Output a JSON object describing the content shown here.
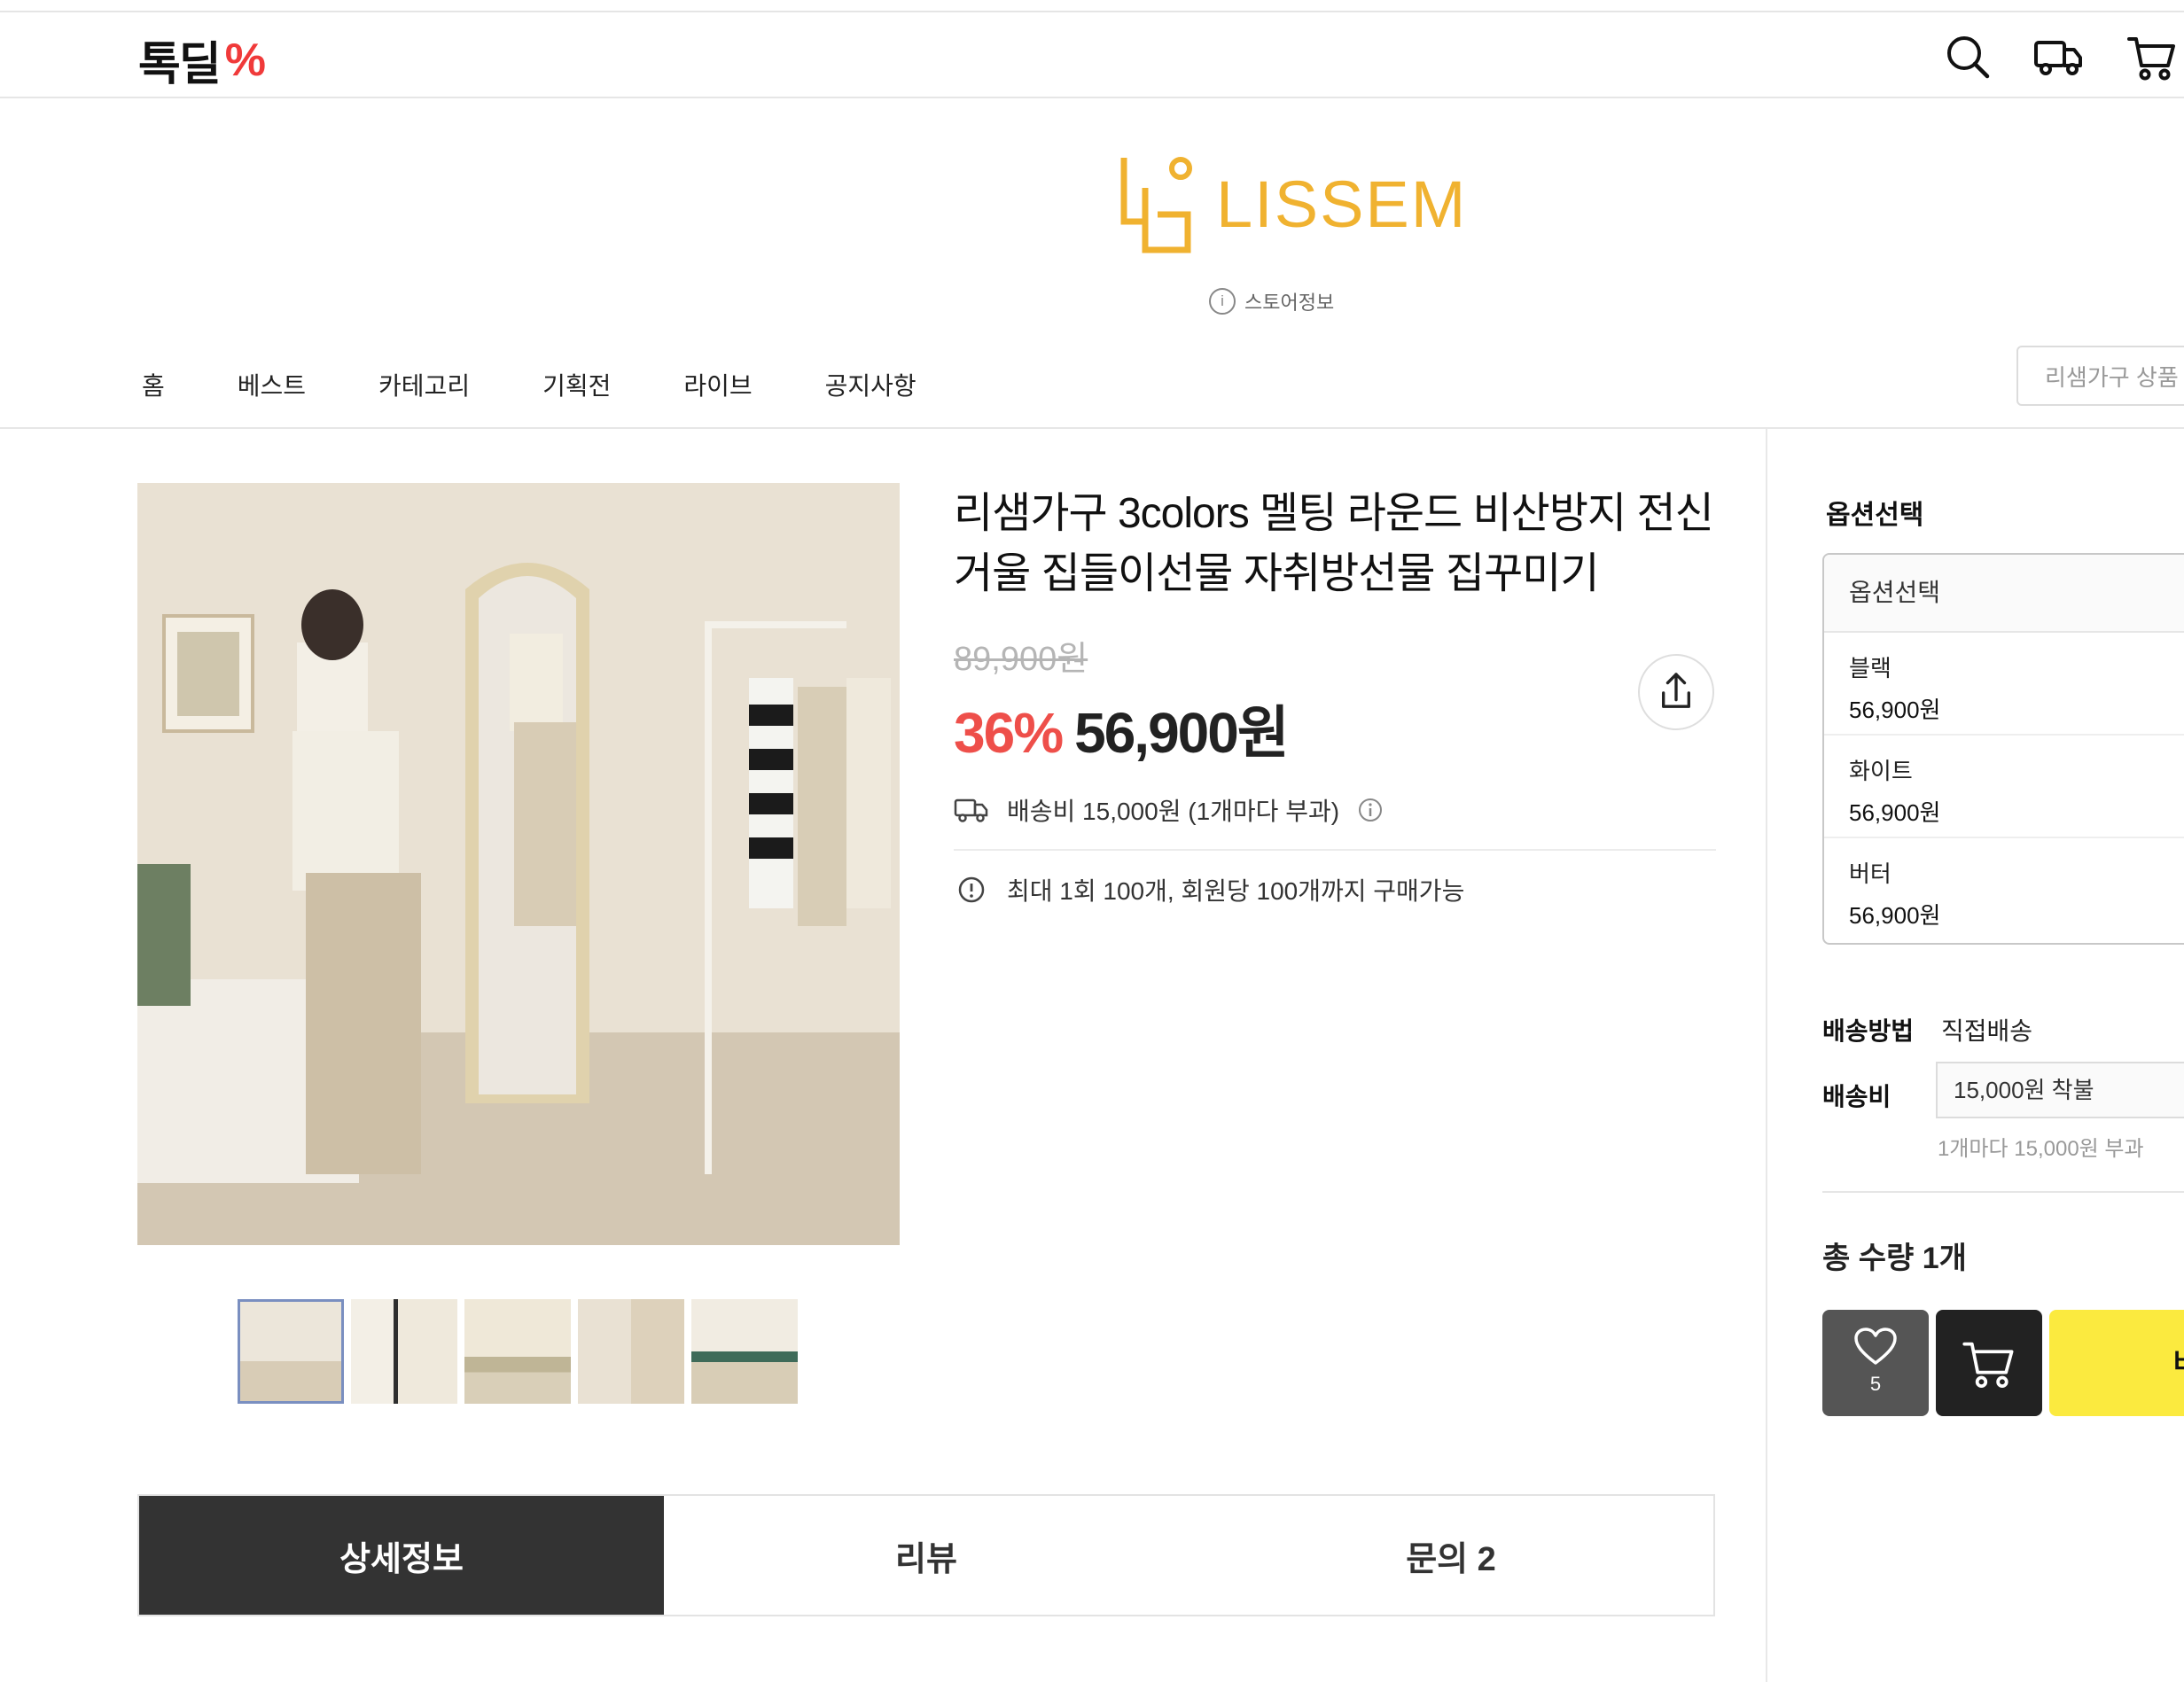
{
  "header": {
    "logo_text": "톡딜",
    "logo_mark": "%",
    "icons": [
      "search-icon",
      "truck-icon",
      "cart-icon"
    ]
  },
  "brand": {
    "name": "LISSEM",
    "store_info": "스토어정보"
  },
  "nav": {
    "items": [
      "홈",
      "베스트",
      "카테고리",
      "기획전",
      "라이브",
      "공지사항"
    ],
    "search_placeholder": "리샘가구 상품"
  },
  "product": {
    "title": "리샘가구 3colors 멜팅 라운드 비산방지 전신거울 집들이선물 자취방선물 집꾸미기",
    "original_price": "89,900원",
    "discount": "36%",
    "price": "56,900원",
    "shipping_info": "배송비 15,000원 (1개마다 부과)",
    "purchase_limit": "최대 1회 100개, 회원당 100개까지 구매가능",
    "thumbnail_count": 5
  },
  "options": {
    "header": "옵션선택",
    "select_label": "옵션선택",
    "items": [
      {
        "name": "블랙",
        "price": "56,900원"
      },
      {
        "name": "화이트",
        "price": "56,900원"
      },
      {
        "name": "버터",
        "price": "56,900원"
      }
    ],
    "delivery_method_label": "배송방법",
    "delivery_method_value": "직접배송",
    "shipping_fee_label": "배송비",
    "shipping_fee_value": "15,000원 착불",
    "shipping_fee_note": "1개마다 15,000원 부과",
    "total_quantity": "총 수량 1개",
    "like_count": "5",
    "buy_label": "바"
  },
  "tabs": [
    "상세정보",
    "리뷰",
    "문의 2"
  ],
  "colors": {
    "discount_red": "#ee4f4a",
    "brand_gold": "#f0b230",
    "buy_yellow": "#fbea3f"
  }
}
